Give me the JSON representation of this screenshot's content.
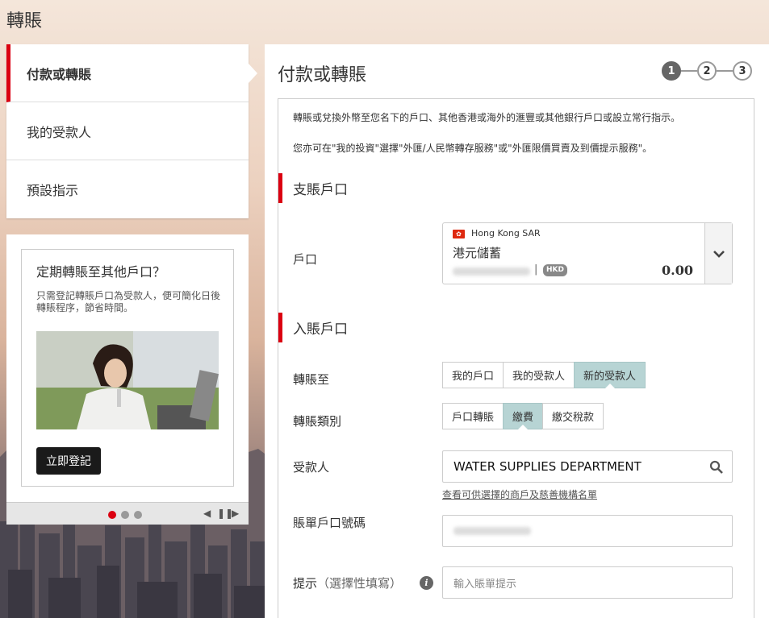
{
  "page": {
    "title": "轉賬"
  },
  "sidebar": {
    "items": [
      {
        "label": "付款或轉賬"
      },
      {
        "label": "我的受款人"
      },
      {
        "label": "預設指示"
      }
    ]
  },
  "promo": {
    "title": "定期轉賬至其他戶口？",
    "description": "只需登記轉賬戶口為受款人，便可簡化日後轉賬程序，節省時間。",
    "button_label": "立即登記"
  },
  "main": {
    "title": "付款或轉賬",
    "steps": [
      "1",
      "2",
      "3"
    ],
    "current_step": 1,
    "intro_1": "轉賬或兌換外幣至您名下的戶口、其他香港或海外的滙豐或其他銀行戶口或設立常行指示。",
    "intro_2": "您亦可在\"我的投資\"選擇\"外匯/人民幣轉存服務\"或\"外匯限價買賣及到價提示服務\"。"
  },
  "debit": {
    "section": "支賬戶口",
    "account_label": "戶口",
    "region": "Hong Kong SAR",
    "account_name": "港元儲蓄",
    "currency": "HKD",
    "balance": "0.00"
  },
  "credit": {
    "section": "入賬戶口",
    "transfer_to_label": "轉賬至",
    "transfer_to_options": [
      "我的戶口",
      "我的受款人",
      "新的受款人"
    ],
    "transfer_to_selected": "新的受款人",
    "type_label": "轉賬類別",
    "type_options": [
      "戶口轉賬",
      "繳費",
      "繳交稅款"
    ],
    "type_selected": "繳費",
    "payee_label": "受款人",
    "payee_value": "WATER SUPPLIES DEPARTMENT",
    "merchant_link": "查看可供選擇的商戶及慈善機構名單",
    "bill_account_label": "賬單戶口號碼",
    "reminder_label": "提示",
    "reminder_optional": "（選擇性填寫）",
    "reminder_placeholder": "輸入賬單提示"
  },
  "colors": {
    "accent": "#db0011",
    "selected": "#b7d4d4"
  }
}
